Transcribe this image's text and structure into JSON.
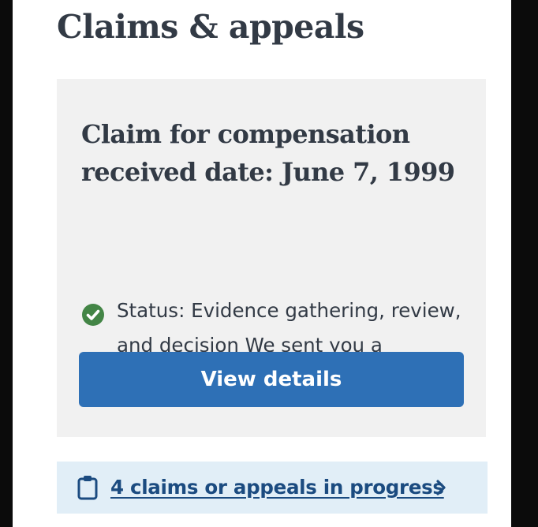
{
  "page": {
    "title": "Claims & appeals"
  },
  "claim_card": {
    "heading": "Claim for compensation received date: June 7, 1999",
    "status_text": "Status: Evidence gathering, review, and decision We sent you a development letter",
    "button_label": "View details"
  },
  "progress_link": {
    "label": "4 claims or appeals in progress"
  },
  "icons": {
    "status": "check-circle-icon",
    "clipboard": "clipboard-icon",
    "chevron": "chevron-right-icon"
  },
  "colors": {
    "heading_text": "#323a45",
    "card_background": "#f1f1f1",
    "success_green": "#438546",
    "button_blue": "#2e70b6",
    "link_bar_background": "#e1eef7",
    "link_text": "#1b4b80"
  }
}
